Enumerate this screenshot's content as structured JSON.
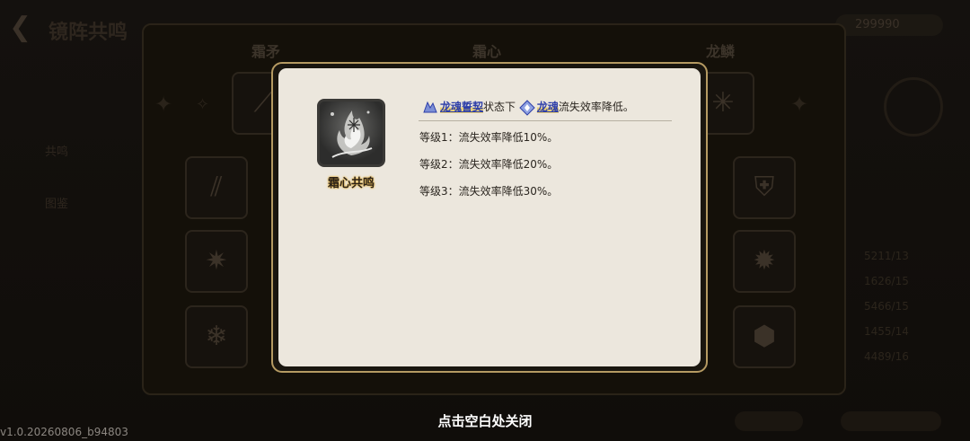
{
  "background": {
    "back_title": "镜阵共鸣",
    "currency_value": "299990",
    "columns": [
      {
        "title": "霜矛"
      },
      {
        "title": "霜心"
      },
      {
        "title": "龙鳞"
      }
    ],
    "left_menu": [
      "共鸣",
      "图鉴"
    ],
    "right_stats": [
      "5211/13",
      "1626/15",
      "5466/15",
      "1455/14",
      "4489/16"
    ]
  },
  "dialog": {
    "skill_name": "霜心共鸣",
    "skill_icon": "frost-heart-icon",
    "description": {
      "link1": "龙魂誓契",
      "mid_text": "状态下",
      "link2": "龙魂",
      "end_text": "流失效率降低。"
    },
    "levels": [
      "等级1：流失效率降低10%。",
      "等级2：流失效率降低20%。",
      "等级3：流失效率降低30%。"
    ]
  },
  "footer": {
    "close_hint": "点击空白处关闭",
    "version": "v1.0.20260806_b94803"
  },
  "colors": {
    "panel_bg": "#ece7dd",
    "frame_gold": "#b59a62",
    "link_blue": "#2d3ea8",
    "highlight_gold": "#e9d079"
  }
}
